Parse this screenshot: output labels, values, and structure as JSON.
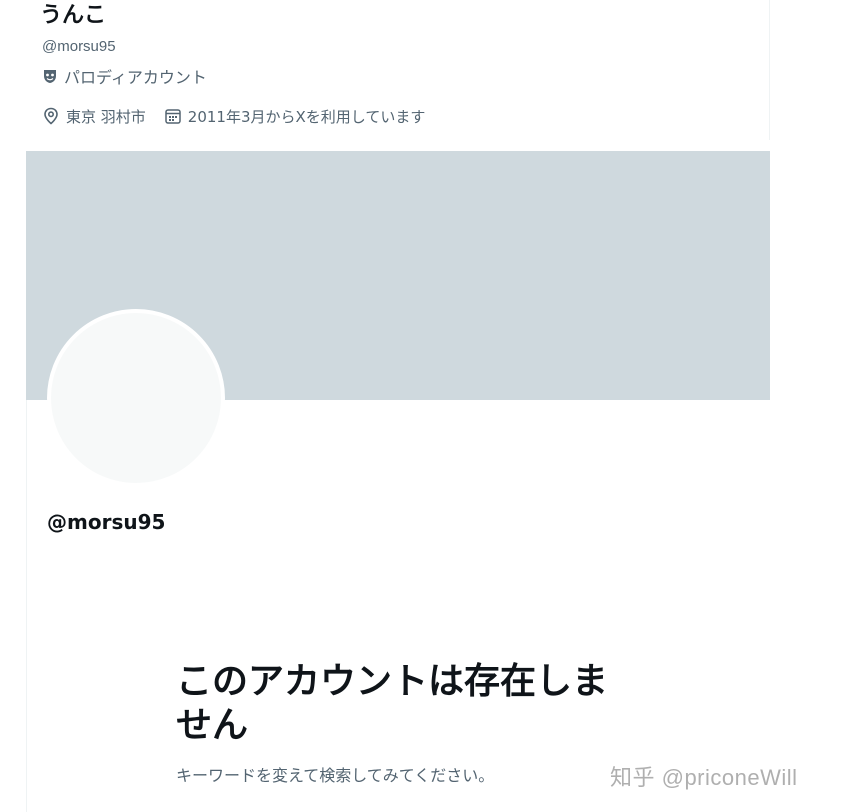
{
  "profile": {
    "display_name": "うんこ",
    "handle": "@morsu95",
    "parody_label": "パロディアカウント",
    "location": "東京 羽村市",
    "joined": "2011年3月からXを利用しています"
  },
  "main": {
    "handle": "@morsu95",
    "empty_title": "このアカウントは存在しません",
    "empty_subtitle": "キーワードを変えて検索してみてください。"
  },
  "watermark": "知乎 @priconeWill",
  "colors": {
    "banner": "#cfd9de",
    "avatar": "#f7f9f9",
    "secondary_text": "#536471",
    "primary_text": "#0f1419"
  },
  "icons": {
    "parody": "parody-mask-icon",
    "location": "location-pin-icon",
    "calendar": "calendar-icon"
  }
}
